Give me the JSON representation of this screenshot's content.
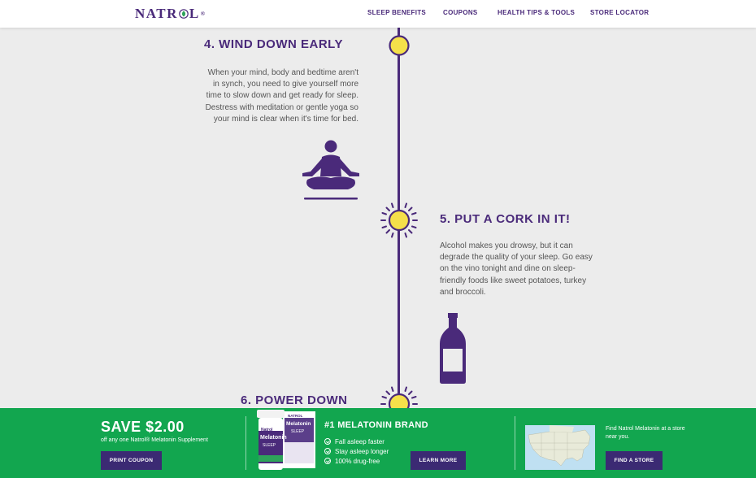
{
  "header": {
    "logo_text_left": "NATR",
    "logo_text_right": "L",
    "logo_mark": "®",
    "nav": [
      {
        "label": "SLEEP BENEFITS"
      },
      {
        "label": "COUPONS"
      },
      {
        "label": "HEALTH TIPS & TOOLS"
      },
      {
        "label": "STORE LOCATOR"
      }
    ]
  },
  "timeline": {
    "steps": [
      {
        "title": "4. WIND DOWN EARLY",
        "body_lines": [
          "When your mind, body and bedtime aren't",
          "in synch, you need to give yourself more",
          "time to slow down and get ready for sleep.",
          "Destress with meditation or gentle yoga so",
          "your mind is clear when it's time for bed."
        ],
        "icon": "meditation-icon"
      },
      {
        "title": "5. PUT A CORK IN IT!",
        "body_lines": [
          "Alcohol makes you drowsy, but it can",
          "degrade the quality of your sleep. Go easy",
          "on the vino tonight and dine on sleep-",
          "friendly foods like sweet potatoes, turkey",
          "and broccoli."
        ],
        "icon": "wine-bottle-icon"
      },
      {
        "title": "6. POWER DOWN"
      }
    ]
  },
  "footer": {
    "coupon": {
      "title": "SAVE $2.00",
      "subtitle": "off any one Natrol® Melatonin Supplement",
      "button": "PRINT COUPON"
    },
    "product": {
      "bottle_brand": "Natrol",
      "bottle_name": "Melatonin",
      "bottle_sub": "SLEEP",
      "box_brand": "NATROL",
      "box_name": "Melatonin",
      "box_sub": "SLEEP"
    },
    "brand": {
      "title": "#1 MELATONIN BRAND",
      "bullets": [
        "Fall asleep faster",
        "Stay asleep longer",
        "100% drug-free"
      ],
      "button": "LEARN MORE"
    },
    "store": {
      "text": "Find Natrol Melatonin at a store near you.",
      "button": "FIND A STORE"
    }
  },
  "colors": {
    "brand_purple": "#4a2a7a",
    "sun_yellow": "#f5e04a",
    "footer_green": "#12a64f",
    "button_purple": "#3b2a73",
    "background": "#ececec"
  }
}
